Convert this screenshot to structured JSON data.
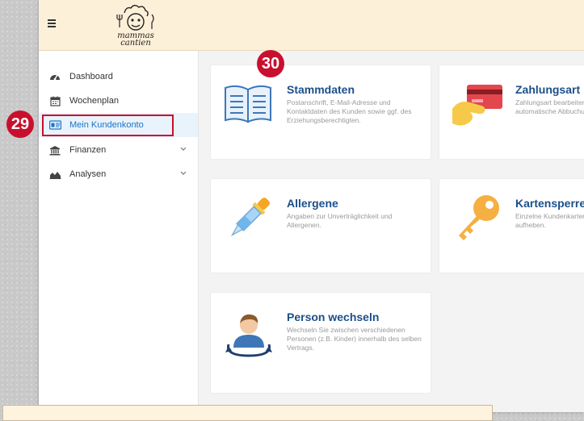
{
  "header": {
    "menu_icon": "hamburger-icon",
    "logo_text_line1": "mammas",
    "logo_text_line2": "cantien"
  },
  "sidebar": {
    "items": [
      {
        "label": "Dashboard",
        "icon": "dashboard-icon"
      },
      {
        "label": "Wochenplan",
        "icon": "calendar-icon"
      },
      {
        "label": "Mein Kundenkonto",
        "icon": "id-card-icon",
        "active": true
      },
      {
        "label": "Finanzen",
        "icon": "bank-icon",
        "expandable": true
      },
      {
        "label": "Analysen",
        "icon": "area-chart-icon",
        "expandable": true
      }
    ]
  },
  "cards": [
    {
      "title": "Stammdaten",
      "description": "Postanschrift, E-Mail-Adresse und Kontaktdaten des Kunden sowie ggf. des Erziehungsberechtigten.",
      "icon": "book-icon"
    },
    {
      "title": "Zahlungsart",
      "description": "Zahlungsart bearbeiten und Daten für die automatische Abbuchung festlegen.",
      "icon": "credit-card-icon"
    },
    {
      "title": "Allergene",
      "description": "Angaben zur Unverträglichkeit und Allergenen.",
      "icon": "pipette-icon"
    },
    {
      "title": "Kartensperre",
      "description": "Einzelne Kundenkarten sperren oder Sperre aufheben.",
      "icon": "key-icon"
    },
    {
      "title": "Person wechseln",
      "description": "Wechseln Sie zwischen verschiedenen Personen (z.B. Kinder) innerhalb des selben Vertrags.",
      "icon": "person-switch-icon"
    }
  ],
  "annotations": {
    "badge_sidebar": "29",
    "badge_card": "30",
    "color": "#c8102e"
  },
  "colors": {
    "header_bg": "#fdf0d8",
    "accent": "#1a73c9",
    "title": "#1b4f8a"
  }
}
